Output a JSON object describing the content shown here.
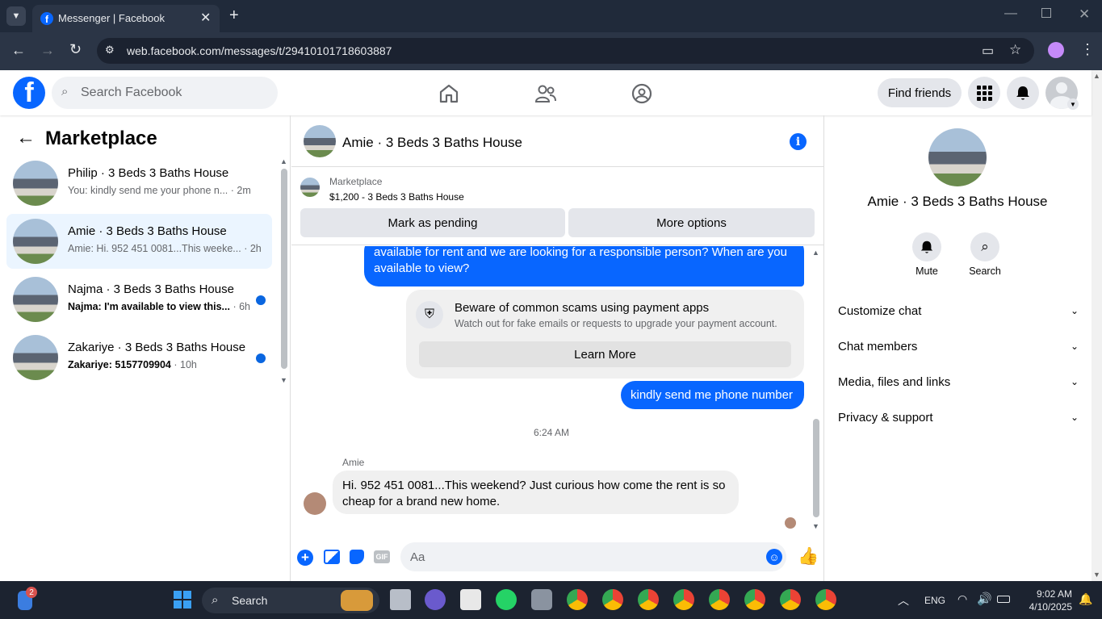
{
  "browser": {
    "tab_title": "Messenger | Facebook",
    "url": "web.facebook.com/messages/t/29410101718603887"
  },
  "header": {
    "search_placeholder": "Search Facebook",
    "find_friends": "Find friends"
  },
  "sidebar": {
    "title": "Marketplace",
    "conversations": [
      {
        "name": "Philip · 3 Beds 3 Baths House",
        "preview": "You: kindly send me your phone n...",
        "time": "· 2m",
        "unread": false
      },
      {
        "name": "Amie · 3 Beds 3 Baths House",
        "preview": "Amie: Hi. 952 451 0081...This weeke...",
        "time": "· 2h",
        "unread": false
      },
      {
        "name": "Najma · 3 Beds 3 Baths House",
        "preview": "Najma: I'm available to view this...",
        "time": "· 6h",
        "unread": true
      },
      {
        "name": "Zakariye · 3 Beds 3 Baths House",
        "preview": "Zakariye: 5157709904",
        "time": "· 10h",
        "unread": true
      }
    ]
  },
  "chat": {
    "title": "Amie · 3 Beds 3 Baths House",
    "listing_source": "Marketplace",
    "listing_text": "$1,200 - 3 Beds 3 Baths House",
    "mark_pending": "Mark as pending",
    "more_options": "More options",
    "msg_out_1_line1": "available for rent and we are looking for a responsible person? When are you",
    "msg_out_1_line2": "available to view?",
    "scam_title": "Beware of common scams using payment apps",
    "scam_text": "Watch out for fake emails or requests to upgrade your payment account.",
    "learn_more": "Learn More",
    "msg_out_2": "kindly send me phone number",
    "timestamp": "6:24 AM",
    "sender_name": "Amie",
    "msg_in_line1": "Hi. 952 451 0081...This weekend? Just curious how come the rent is so",
    "msg_in_line2": "cheap for a brand new home.",
    "composer_placeholder": "Aa"
  },
  "details": {
    "name": "Amie · 3 Beds 3 Baths House",
    "mute": "Mute",
    "search": "Search",
    "sections": [
      "Customize chat",
      "Chat members",
      "Media, files and links",
      "Privacy & support"
    ]
  },
  "taskbar": {
    "search": "Search",
    "lang": "ENG",
    "time": "9:02 AM",
    "date": "4/10/2025",
    "badge": "2"
  },
  "colors": {
    "brand": "#0866ff",
    "chrome_bg": "#202a3a"
  }
}
